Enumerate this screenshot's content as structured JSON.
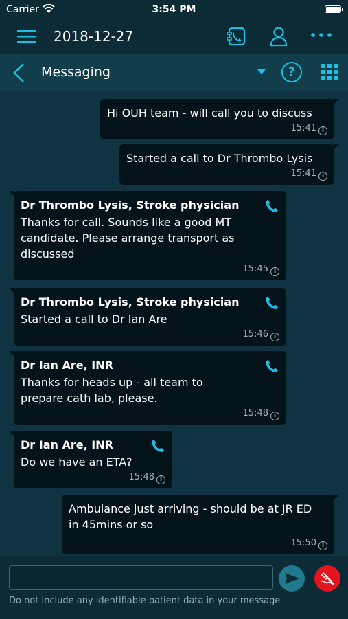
{
  "status_bar": {
    "carrier": "Carrier",
    "time": "3:54 PM"
  },
  "header": {
    "date": "2018-12-27"
  },
  "subheader": {
    "title": "Messaging",
    "help_label": "?"
  },
  "messages": [
    {
      "direction": "outgoing",
      "text": "Hi OUH team - will call you to discuss",
      "time": "15:41"
    },
    {
      "direction": "outgoing",
      "text": "Started a call to Dr Thrombo Lysis",
      "time": "15:41"
    },
    {
      "direction": "incoming",
      "sender": "Dr Thrombo Lysis, Stroke physician",
      "text": "Thanks for call. Sounds like a good MT candidate. Please arrange transport as discussed",
      "time": "15:45"
    },
    {
      "direction": "incoming",
      "sender": "Dr Thrombo Lysis, Stroke physician",
      "text": "Started a call to Dr Ian Are",
      "time": "15:46"
    },
    {
      "direction": "incoming",
      "sender": "Dr Ian Are, INR",
      "text": "Thanks for heads up - all team to prepare cath lab, please.",
      "time": "15:48"
    },
    {
      "direction": "incoming",
      "sender": "Dr Ian Are, INR",
      "text": "Do we have an ETA?",
      "time": "15:48"
    },
    {
      "direction": "outgoing",
      "text": "Ambulance just arriving - should be at JR ED in 45mins or so",
      "time": "15:50"
    }
  ],
  "composer": {
    "value": "",
    "placeholder": "",
    "disclaimer": "Do not include any identifiable patient data in your message"
  },
  "colors": {
    "accent": "#19c1e6",
    "bubble": "#031319",
    "background": "#0f3340",
    "emergency": "#e3141d"
  }
}
